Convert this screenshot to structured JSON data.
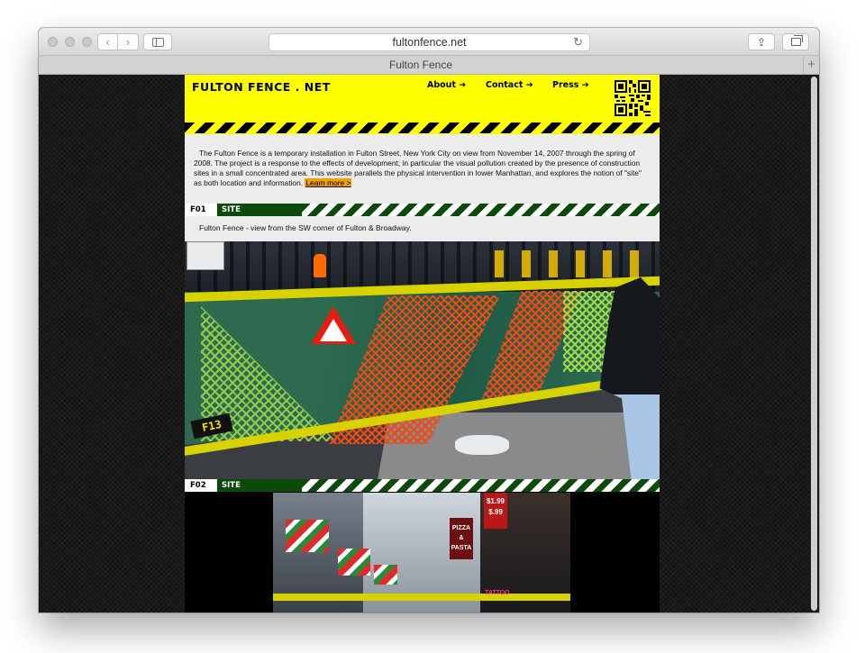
{
  "browser": {
    "url": "fultonfence.net",
    "tab_title": "Fulton Fence",
    "back_glyph": "‹",
    "forward_glyph": "›",
    "reload_glyph": "↻",
    "share_glyph": "⇪",
    "new_tab_glyph": "+"
  },
  "site": {
    "logo": "FULTON FENCE . NET",
    "nav": [
      {
        "label": "About ➔"
      },
      {
        "label": "Contact ➔"
      },
      {
        "label": "Press ➔"
      }
    ],
    "intro": "The Fulton Fence is a temporary installation in Fulton Street, New York City on view from November 14, 2007 through the spring of 2008. The project is a response to the effects of development; in particular the visual pollution created by the presence of construction sites in a small concentrated area. This website parallels the physical intervention in lower Manhattan, and explores the notion of \"site\" as both location and information.",
    "learn_more": "Learn more >",
    "sections": [
      {
        "code": "F01",
        "label": "SITE",
        "caption": "Fulton Fence - view from the SW corner of Fulton & Broadway."
      },
      {
        "code": "F02",
        "label": "SITE"
      }
    ],
    "photo1_texts": {
      "fence_tag": "F13"
    },
    "photo2_texts": {
      "pizza_sign": "PIZZA & PASTA",
      "price_sign": "$1.99 $.99",
      "tattoo_sign": "TATTOO"
    }
  },
  "colors": {
    "header_yellow": "#ffff00",
    "section_green": "#0b4a0b",
    "learn_more_bg": "#f0a000"
  }
}
